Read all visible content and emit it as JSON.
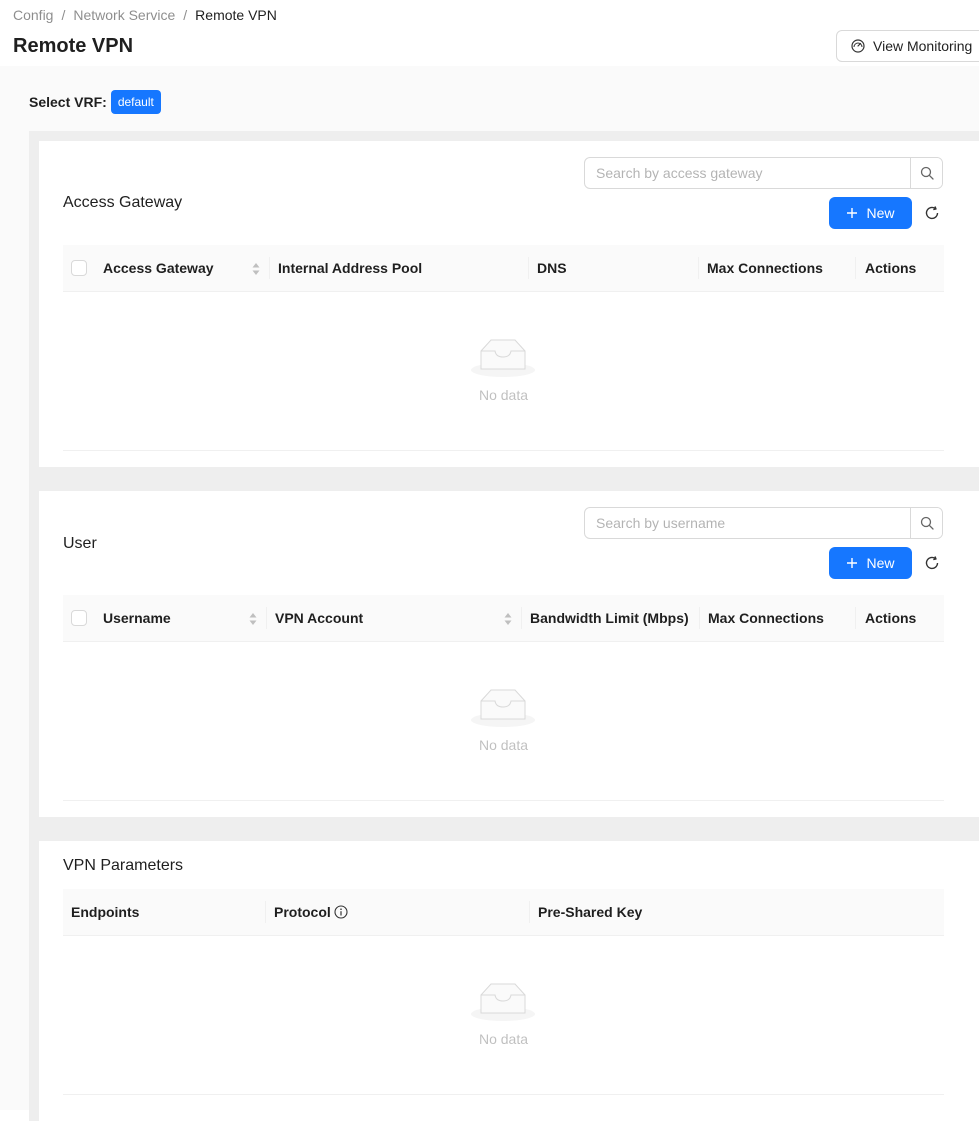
{
  "breadcrumb": {
    "items": [
      "Config",
      "Network Service",
      "Remote VPN"
    ],
    "separator": "/"
  },
  "page": {
    "title": "Remote VPN",
    "monitor_label": "View Monitoring",
    "monitor_icon": "dashboard-icon"
  },
  "vrf": {
    "label": "Select VRF:",
    "value": "default"
  },
  "access_gateway": {
    "title": "Access Gateway",
    "search_placeholder": "Search by access gateway",
    "new_label": "New",
    "columns": [
      "Access Gateway",
      "Internal Address Pool",
      "DNS",
      "Max Connections",
      "Actions"
    ],
    "rows": [],
    "empty_text": "No data"
  },
  "user": {
    "title": "User",
    "search_placeholder": "Search by username",
    "new_label": "New",
    "columns": [
      "Username",
      "VPN Account",
      "Bandwidth Limit (Mbps)",
      "Max Connections",
      "Actions"
    ],
    "rows": [],
    "empty_text": "No data"
  },
  "vpn_params": {
    "title": "VPN Parameters",
    "columns": [
      "Endpoints",
      "Protocol",
      "Pre-Shared Key"
    ],
    "rows": [],
    "empty_text": "No data"
  },
  "colors": {
    "primary": "#1677ff",
    "border": "#d9d9d9",
    "header_bg": "#fafafa"
  }
}
